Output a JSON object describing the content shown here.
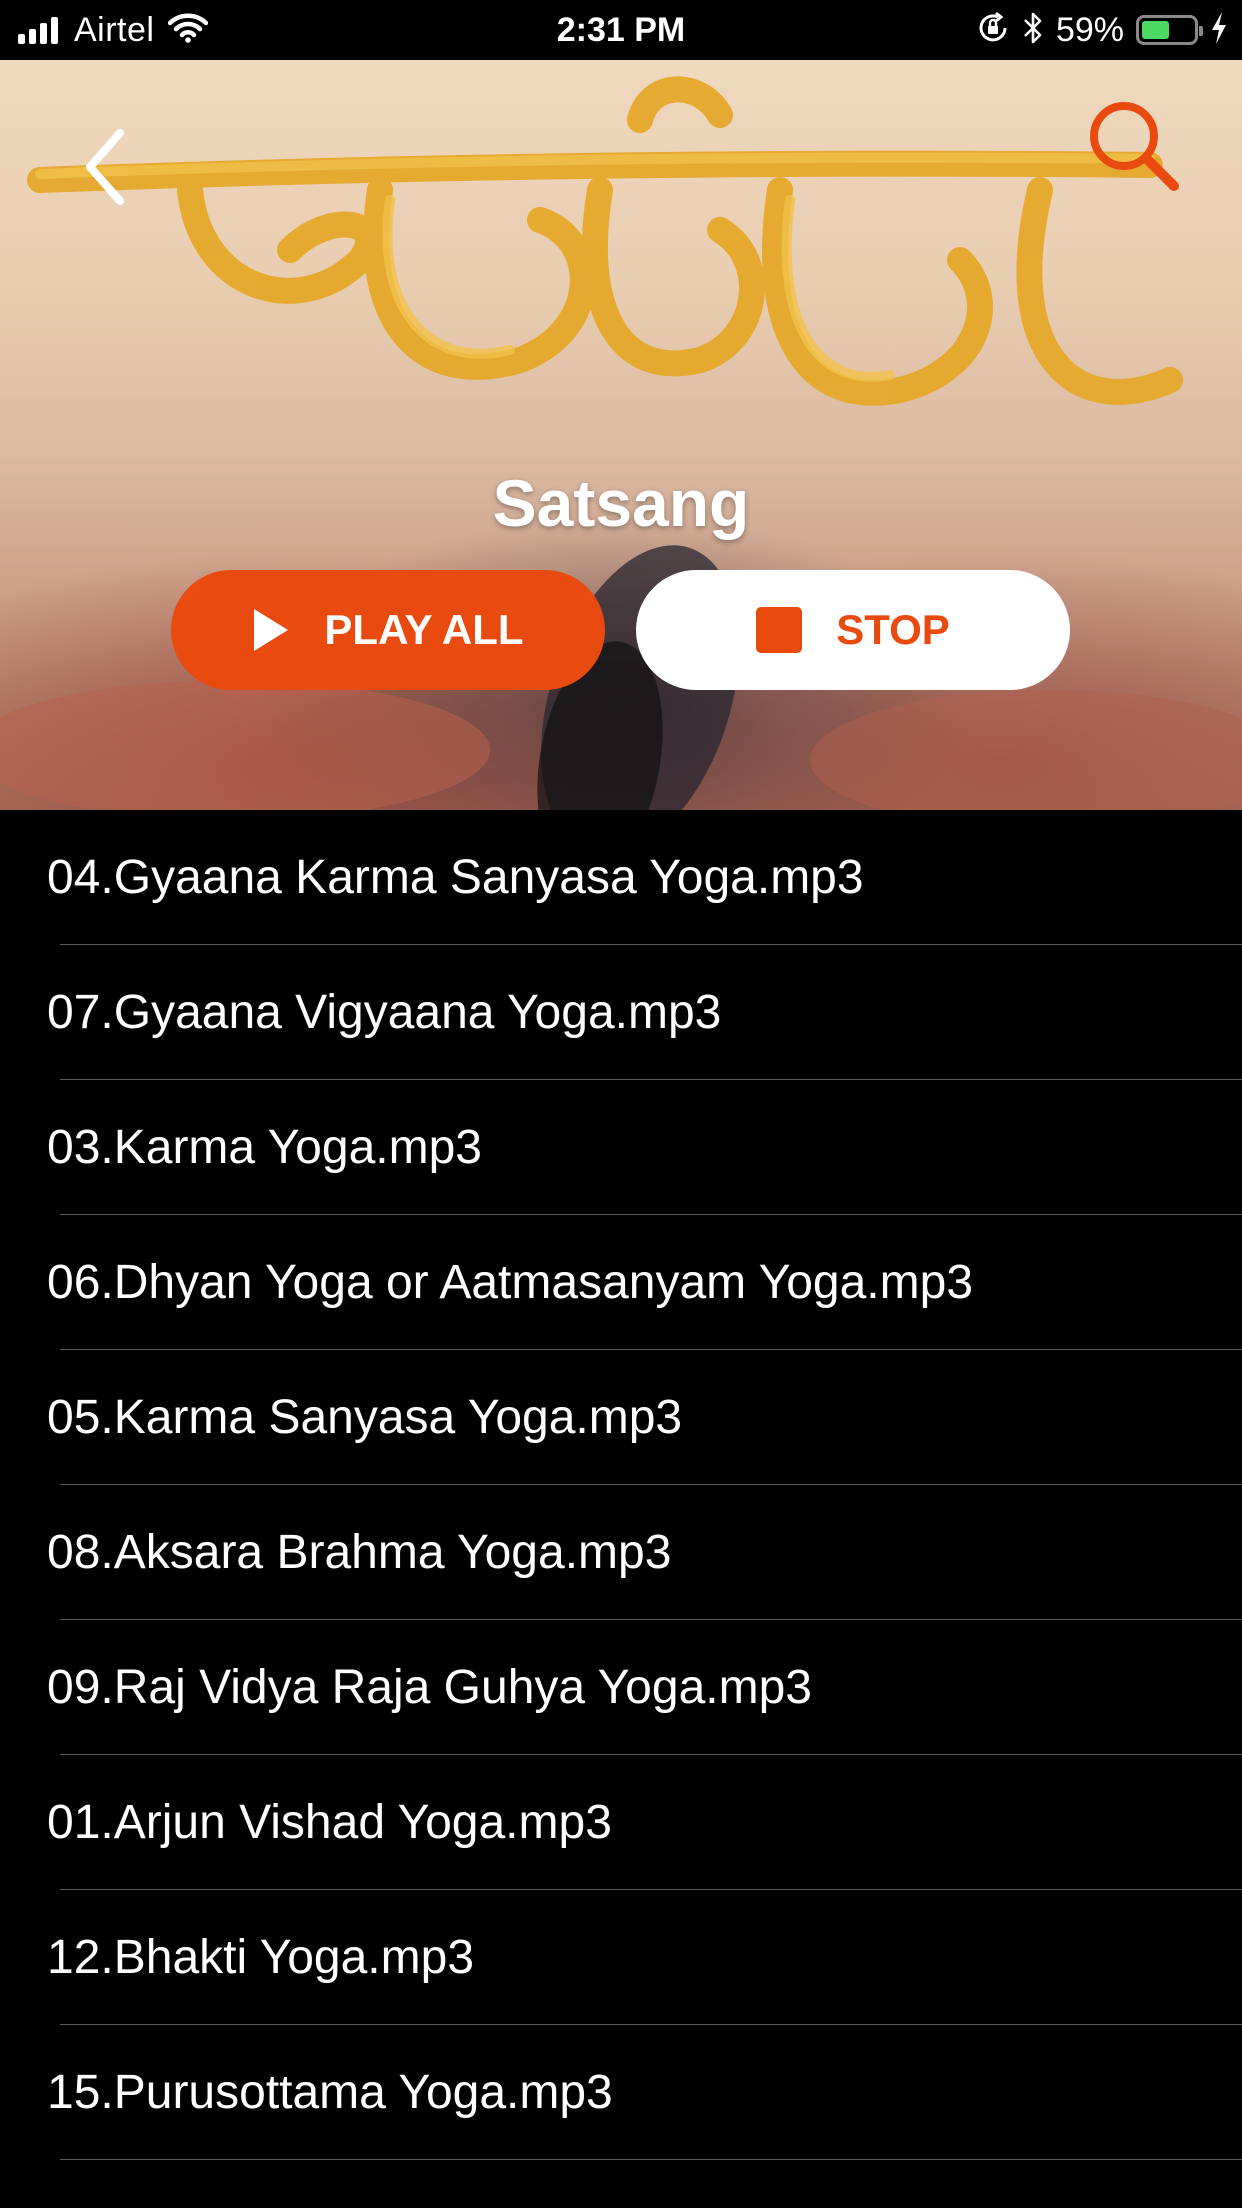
{
  "status_bar": {
    "carrier": "Airtel",
    "time": "2:31 PM",
    "battery_percent": "59%",
    "battery_level": 0.59
  },
  "header": {
    "title": "Satsang",
    "back_icon": "chevron-left-icon",
    "search_icon": "search-icon",
    "accent_color": "#e84a0f"
  },
  "controls": {
    "play_all_label": "PLAY ALL",
    "stop_label": "STOP"
  },
  "tracks": [
    "04.Gyaana Karma Sanyasa Yoga.mp3",
    "07.Gyaana Vigyaana Yoga.mp3",
    "03.Karma Yoga.mp3",
    "06.Dhyan Yoga or Aatmasanyam Yoga.mp3",
    "05.Karma Sanyasa Yoga.mp3",
    "08.Aksara Brahma Yoga.mp3",
    "09.Raj Vidya Raja Guhya Yoga.mp3",
    "01.Arjun Vishad Yoga.mp3",
    "12.Bhakti Yoga.mp3",
    "15.Purusottama Yoga.mp3"
  ]
}
